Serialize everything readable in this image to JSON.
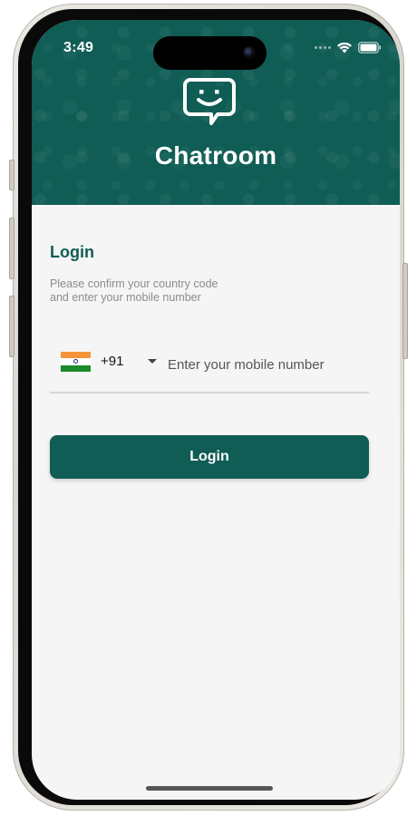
{
  "status_bar": {
    "time": "3:49"
  },
  "header": {
    "logo_icon": "chat-smiley-icon",
    "title": "Chatroom",
    "color": "#0f5d55"
  },
  "form": {
    "heading": "Login",
    "instructions_line1": "Please confirm your country code",
    "instructions_line2": "and enter your mobile number",
    "country": {
      "flag_icon": "india-flag-icon",
      "dial_code": "+91"
    },
    "phone_input": {
      "value": "",
      "placeholder": "Enter your mobile number"
    },
    "login_button": "Login",
    "accent_color": "#0f5d55"
  }
}
